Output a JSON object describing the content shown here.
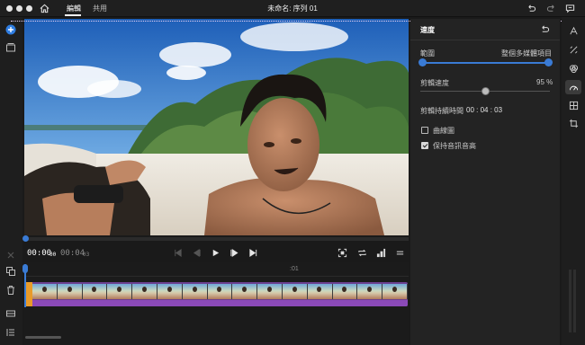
{
  "titlebar": {
    "tabs": [
      "編輯",
      "共用"
    ],
    "active_tab": "編輯",
    "document_title": "未命名: 序列 01"
  },
  "playback": {
    "current_time": "00:00",
    "current_frames": "00",
    "duration": "00:04",
    "duration_frames": "03"
  },
  "timeline": {
    "ruler_label": ":01",
    "clip_thumbnail_count": 15
  },
  "speed_panel": {
    "title": "速度",
    "range_label": "範圍",
    "range_value": "整個多媒體項目",
    "clip_speed_label": "剪輯速度",
    "clip_speed_value": "95 %",
    "clip_speed_percent": 95,
    "clip_duration_label": "剪輯持續時間",
    "clip_duration_value": "00 : 04 : 03",
    "curve_checkbox_label": "曲線圖",
    "curve_checked": false,
    "maintain_pitch_label": "保持音訊音高",
    "maintain_pitch_checked": true
  },
  "colors": {
    "accent": "#3a7bd5",
    "clip_video": "#e89b2a",
    "clip_audio": "#8b4ab8"
  },
  "icons": {
    "left_rail": [
      "add-icon",
      "media-icon",
      "cut-icon",
      "duplicate-icon",
      "trash-icon",
      "captions-icon",
      "tracks-icon"
    ],
    "right_rail": [
      "titles-icon",
      "transition-icon",
      "color-icon",
      "speed-icon",
      "transform-icon",
      "crop-icon"
    ]
  }
}
